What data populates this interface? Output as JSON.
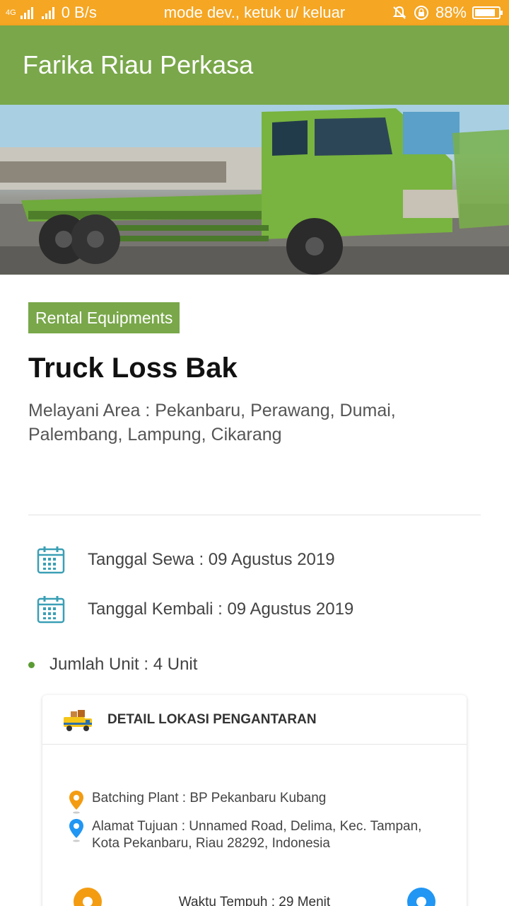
{
  "status_bar": {
    "network": "4G",
    "speed": "0 B/s",
    "notice": "mode dev., ketuk u/ keluar",
    "battery": "88%",
    "battery_level": 0.88
  },
  "app_bar": {
    "title": "Farika Riau Perkasa"
  },
  "hero": {
    "image": "green-flatbed-truck-photo"
  },
  "listing": {
    "category": "Rental Equipments",
    "title": "Truck Loss Bak",
    "area": "Melayani Area : Pekanbaru, Perawang, Dumai, Palembang, Lampung, Cikarang"
  },
  "dates": {
    "rent": "Tanggal Sewa : 09 Agustus 2019",
    "return": "Tanggal Kembali : 09 Agustus 2019"
  },
  "units": "Jumlah Unit : 4 Unit",
  "delivery": {
    "title": "DETAIL LOKASI PENGANTARAN",
    "batching_plant": "Batching Plant : BP Pekanbaru Kubang",
    "address": "Alamat Tujuan : Unnamed Road, Delima, Kec. Tampan, Kota Pekanbaru, Riau 28292, Indonesia",
    "travel_time": "Waktu Tempuh : 29 Menit"
  },
  "colors": {
    "status_bar": "#f5a623",
    "primary_green": "#79a74a",
    "pin_orange": "#f39c12",
    "pin_blue": "#2196f3",
    "calendar_teal": "#3a9fb5"
  }
}
